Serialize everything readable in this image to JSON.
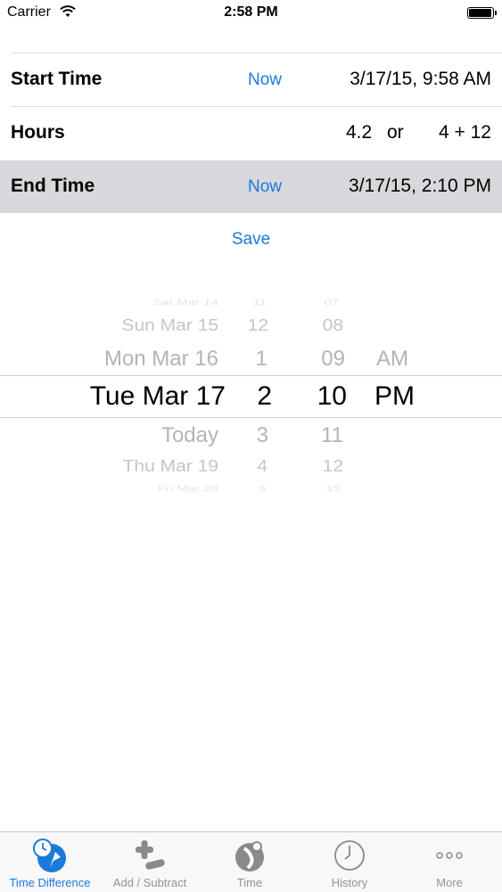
{
  "status_bar": {
    "carrier": "Carrier",
    "time": "2:58 PM"
  },
  "rows": {
    "start": {
      "label": "Start Time",
      "now": "Now",
      "value": "3/17/15, 9:58 AM"
    },
    "hours": {
      "label": "Hours",
      "decimal": "4.2",
      "or": "or",
      "hm": "4 + 12"
    },
    "end": {
      "label": "End Time",
      "now": "Now",
      "value": "3/17/15, 2:10 PM"
    }
  },
  "save_label": "Save",
  "picker": {
    "dates": [
      "Sat Mar 14",
      "Sun Mar 15",
      "Mon Mar 16",
      "Tue Mar 17",
      "Today",
      "Thu Mar 19",
      "Fri Mar 20"
    ],
    "hours": [
      "11",
      "12",
      "1",
      "2",
      "3",
      "4",
      "5"
    ],
    "minutes": [
      "07",
      "08",
      "09",
      "10",
      "11",
      "12",
      "13"
    ],
    "ampm": [
      "AM",
      "PM"
    ]
  },
  "tabs": [
    {
      "label": "Time Difference",
      "icon": "clock-compass-icon",
      "active": true
    },
    {
      "label": "Add / Subtract",
      "icon": "plus-minus-icon",
      "active": false
    },
    {
      "label": "Time",
      "icon": "time-globe-icon",
      "active": false
    },
    {
      "label": "History",
      "icon": "history-clock-icon",
      "active": false
    },
    {
      "label": "More",
      "icon": "more-dots-icon",
      "active": false
    }
  ],
  "colors": {
    "accent": "#1a7ad9",
    "selected_row": "#d8d8dc",
    "tab_inactive": "#929292"
  }
}
